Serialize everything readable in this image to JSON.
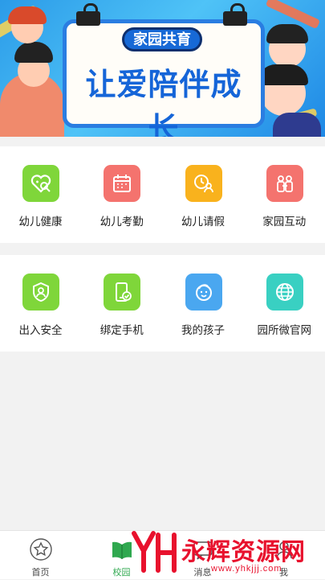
{
  "banner": {
    "tag": "家园共育",
    "slogan": "让爱陪伴成长"
  },
  "menu_row1": [
    {
      "label": "幼儿健康",
      "icon": "heart-search-icon",
      "color": "#7fd63a"
    },
    {
      "label": "幼儿考勤",
      "icon": "calendar-icon",
      "color": "#f4736e"
    },
    {
      "label": "幼儿请假",
      "icon": "clock-person-icon",
      "color": "#f9b21d"
    },
    {
      "label": "家园互动",
      "icon": "people-icon",
      "color": "#f4736e"
    }
  ],
  "menu_row2": [
    {
      "label": "出入安全",
      "icon": "shield-user-icon",
      "color": "#7fd63a"
    },
    {
      "label": "绑定手机",
      "icon": "phone-check-icon",
      "color": "#7fd63a"
    },
    {
      "label": "我的孩子",
      "icon": "child-face-icon",
      "color": "#4aa7f0"
    },
    {
      "label": "园所微官网",
      "icon": "globe-icon",
      "color": "#39d0c2"
    }
  ],
  "tabbar": {
    "items": [
      {
        "label": "首页",
        "icon": "star-icon"
      },
      {
        "label": "校园",
        "icon": "book-icon"
      },
      {
        "label": "消息",
        "icon": "message-icon"
      },
      {
        "label": "我",
        "icon": "user-icon"
      }
    ],
    "active_color": "#2fa84f"
  },
  "watermark": {
    "text": "永辉资源网",
    "url": "www.yhkjjj.com"
  }
}
